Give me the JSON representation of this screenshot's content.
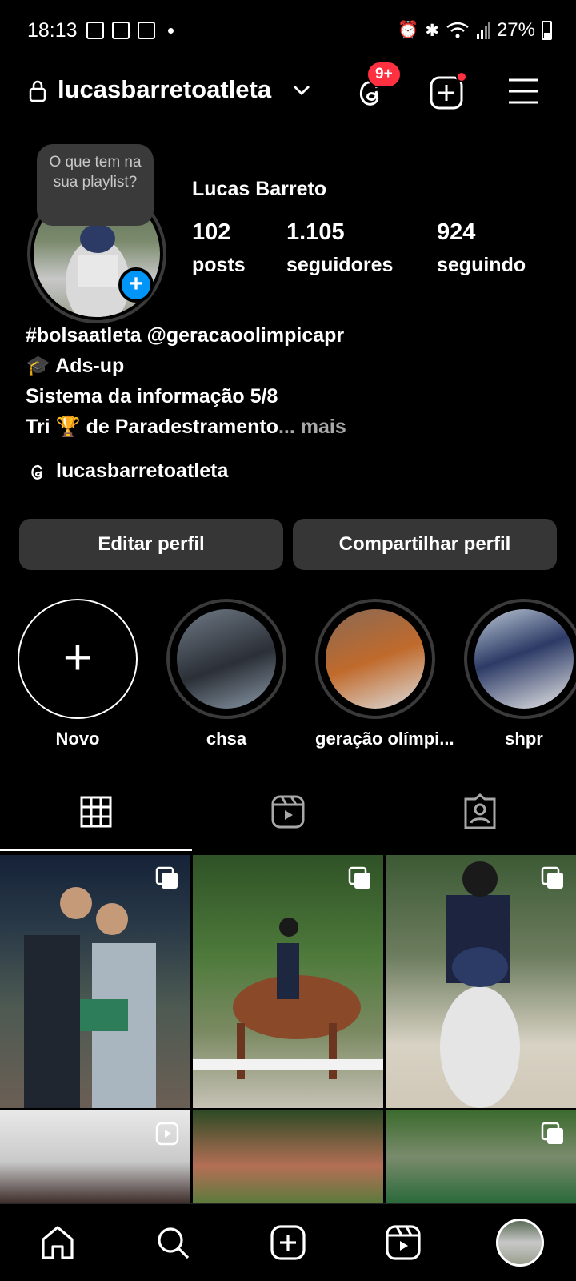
{
  "status_bar": {
    "time": "18:13",
    "battery": "27%",
    "icons": [
      "news-icon",
      "gallery-icon",
      "sim-icon",
      "alarm-icon",
      "bluetooth-icon",
      "wifi-icon",
      "signal-icon",
      "battery-icon"
    ]
  },
  "header": {
    "username": "lucasbarretoatleta",
    "threads_badge": "9+",
    "colors": {
      "badge": "#ff3040",
      "accent": "#0095f6"
    }
  },
  "profile": {
    "note": "O que tem na sua playlist?",
    "full_name": "Lucas Barreto",
    "stats": [
      {
        "value": "102",
        "label": "posts"
      },
      {
        "value": "1.105",
        "label": "seguidores"
      },
      {
        "value": "924",
        "label": "seguindo"
      }
    ],
    "bio": {
      "line1": "#bolsaatleta @geracaoolimpicapr",
      "line2_emoji": "🎓",
      "line2": " Ads-up",
      "line3": "Sistema da informação  5/8",
      "line4_pre": " Tri ",
      "line4_emoji": "🏆",
      "line4": " de Paradestramento",
      "more": "... mais"
    },
    "threads_handle": "lucasbarretoatleta"
  },
  "buttons": {
    "edit": "Editar perfil",
    "share": "Compartilhar perfil"
  },
  "highlights": [
    {
      "label": "Novo"
    },
    {
      "label": "chsa"
    },
    {
      "label": "geração olímpi..."
    },
    {
      "label": "shpr"
    }
  ],
  "tabs": [
    "grid-icon",
    "reels-icon",
    "tagged-icon"
  ],
  "bottom_nav": [
    "home-icon",
    "search-icon",
    "create-icon",
    "reels-icon",
    "profile-avatar"
  ]
}
